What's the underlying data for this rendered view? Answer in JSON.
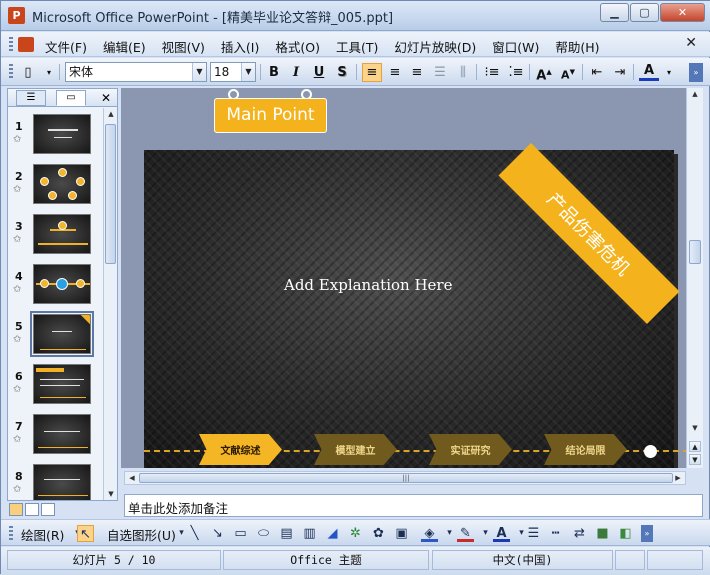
{
  "window": {
    "title": "Microsoft Office PowerPoint - [精美毕业论文答辩_005.ppt]",
    "app_icon": "P"
  },
  "menu": {
    "items": [
      "文件(F)",
      "编辑(E)",
      "视图(V)",
      "插入(I)",
      "格式(O)",
      "工具(T)",
      "幻灯片放映(D)",
      "窗口(W)",
      "帮助(H)"
    ],
    "close_glyph": "✕"
  },
  "toolbar": {
    "font_name": "宋体",
    "font_size": "18",
    "bold": "B",
    "italic": "I",
    "underline": "U",
    "shadow": "S",
    "font_color_label": "A"
  },
  "slides_panel": {
    "close_glyph": "✕",
    "slides": [
      {
        "number": "1"
      },
      {
        "number": "2"
      },
      {
        "number": "3"
      },
      {
        "number": "4"
      },
      {
        "number": "5"
      },
      {
        "number": "6"
      },
      {
        "number": "7"
      },
      {
        "number": "8"
      }
    ],
    "selected": "5"
  },
  "slide": {
    "main_point": "Main Point",
    "explanation": "Add Explanation Here",
    "banner": "产品伤害危机",
    "steps": [
      "文献综述",
      "模型建立",
      "实证研究",
      "结论局限"
    ]
  },
  "notes": {
    "placeholder": "单击此处添加备注"
  },
  "drawing_toolbar": {
    "draw_label": "绘图(R)",
    "autoshapes_label": "自选图形(U)"
  },
  "status": {
    "slide_position": "幻灯片 5 / 10",
    "theme": "Office 主题",
    "language": "中文(中国)"
  },
  "colors": {
    "accent": "#f4b31c",
    "title_bar": "#c9d8ee",
    "slide_background": "#2a2a2a"
  }
}
